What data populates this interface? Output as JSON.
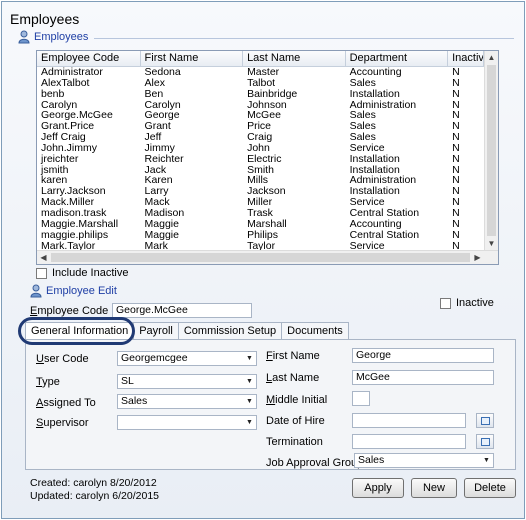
{
  "window": {
    "title": "Employees"
  },
  "employees_section": {
    "title": "Employees"
  },
  "grid": {
    "columns": [
      "Employee Code",
      "First Name",
      "Last Name",
      "Department",
      "Inactive"
    ],
    "rows": [
      [
        "Administrator",
        "Sedona",
        "Master",
        "Accounting",
        "N"
      ],
      [
        "AlexTalbot",
        "Alex",
        "Talbot",
        "Sales",
        "N"
      ],
      [
        "benb",
        "Ben",
        "Bainbridge",
        "Installation",
        "N"
      ],
      [
        "Carolyn",
        "Carolyn",
        "Johnson",
        "Administration",
        "N"
      ],
      [
        "George.McGee",
        "George",
        "McGee",
        "Sales",
        "N"
      ],
      [
        "Grant.Price",
        "Grant",
        "Price",
        "Sales",
        "N"
      ],
      [
        "Jeff Craig",
        "Jeff",
        "Craig",
        "Sales",
        "N"
      ],
      [
        "John.Jimmy",
        "Jimmy",
        "John",
        "Service",
        "N"
      ],
      [
        "jreichter",
        "Reichter",
        "Electric",
        "Installation",
        "N"
      ],
      [
        "jsmith",
        "Jack",
        "Smith",
        "Installation",
        "N"
      ],
      [
        "karen",
        "Karen",
        "Mills",
        "Administration",
        "N"
      ],
      [
        "Larry.Jackson",
        "Larry",
        "Jackson",
        "Installation",
        "N"
      ],
      [
        "Mack.Miller",
        "Mack",
        "Miller",
        "Service",
        "N"
      ],
      [
        "madison.trask",
        "Madison",
        "Trask",
        "Central Station",
        "N"
      ],
      [
        "Maggie.Marshall",
        "Maggie",
        "Marshall",
        "Accounting",
        "N"
      ],
      [
        "maggie.philips",
        "Maggie",
        "Philips",
        "Central Station",
        "N"
      ],
      [
        "Mark.Taylor",
        "Mark",
        "Taylor",
        "Service",
        "N"
      ]
    ]
  },
  "include_inactive": {
    "label": "Include Inactive"
  },
  "edit_section": {
    "title": "Employee Edit"
  },
  "employee_code": {
    "label": "Employee Code",
    "value": "George.McGee"
  },
  "inactive_check": {
    "label": "Inactive"
  },
  "tabs": [
    "General Information",
    "Payroll",
    "Commission Setup",
    "Documents"
  ],
  "general": {
    "user_code": {
      "label": "User Code",
      "value": "Georgemcgee"
    },
    "type": {
      "label": "Type",
      "value": "SL"
    },
    "assigned_to": {
      "label": "Assigned To",
      "value": "Sales"
    },
    "supervisor": {
      "label": "Supervisor",
      "value": ""
    },
    "first_name": {
      "label": "First Name",
      "value": "George"
    },
    "last_name": {
      "label": "Last Name",
      "value": "McGee"
    },
    "middle_initial": {
      "label": "Middle Initial",
      "value": ""
    },
    "date_of_hire": {
      "label": "Date of Hire",
      "value": ""
    },
    "termination": {
      "label": "Termination",
      "value": ""
    },
    "job_approval_group": {
      "label": "Job Approval Group",
      "value": "Sales"
    }
  },
  "footer": {
    "created": "Created: carolyn 8/20/2012",
    "updated": "Updated: carolyn 6/20/2015"
  },
  "buttons": {
    "apply": "Apply",
    "new": "New",
    "delete": "Delete"
  }
}
